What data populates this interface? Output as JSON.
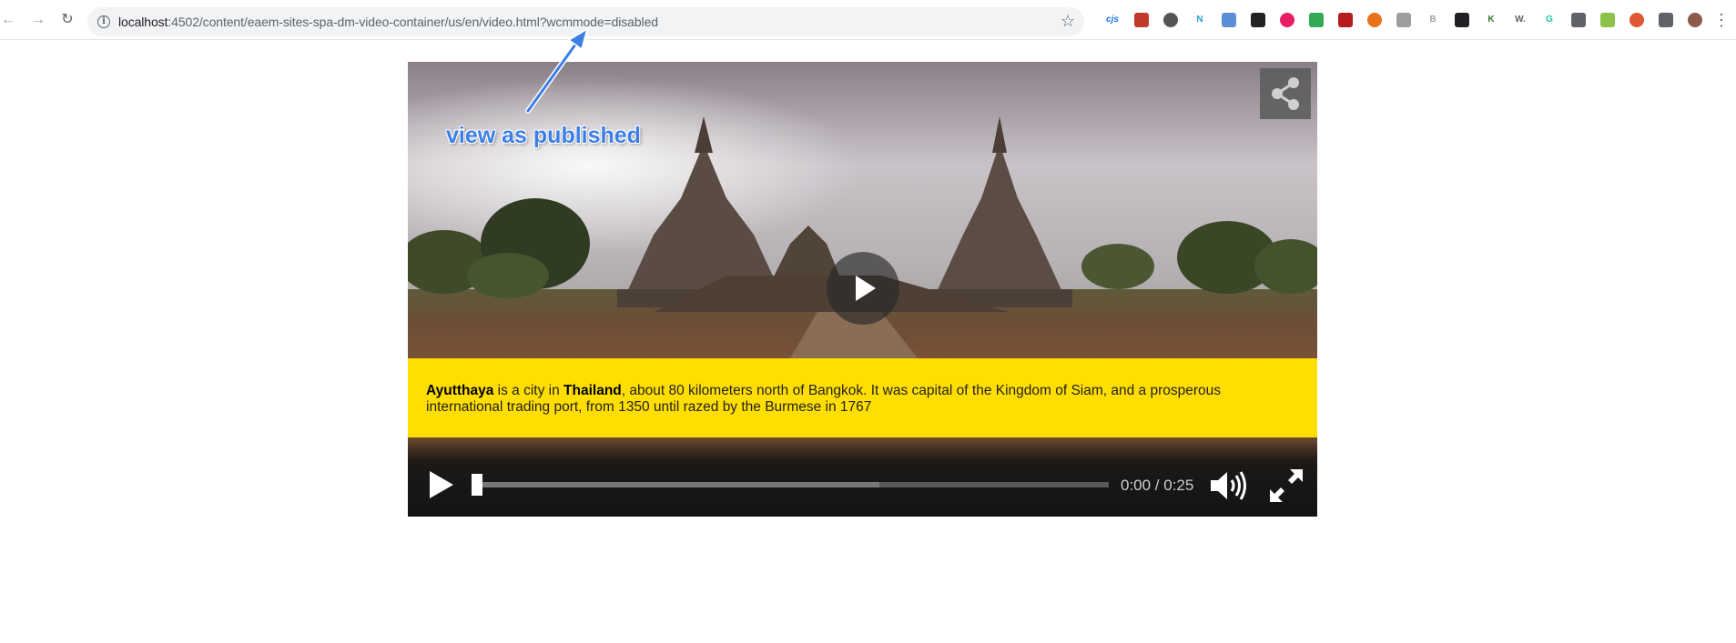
{
  "browser": {
    "url_host": "localhost",
    "url_rest": ":4502/content/eaem-sites-spa-dm-video-container/us/en/video.html?wcmmode=disabled",
    "extensions": [
      {
        "icon": "cjs-extension-icon",
        "label": "cjs",
        "color": "#1a73e8"
      },
      {
        "icon": "pen-extension-icon",
        "label": "",
        "color": "#c0392b"
      },
      {
        "icon": "circle-extension-icon",
        "label": "",
        "color": "#555555"
      },
      {
        "icon": "n-extension-icon",
        "label": "N",
        "color": "#2a9fd6"
      },
      {
        "icon": "globe-extension-icon",
        "label": "",
        "color": "#5b8dd6"
      },
      {
        "icon": "hat-extension-icon",
        "label": "",
        "color": "#222222"
      },
      {
        "icon": "target-extension-icon",
        "label": "",
        "color": "#e91e63"
      },
      {
        "icon": "drive-extension-icon",
        "label": "",
        "color": "#34a853"
      },
      {
        "icon": "square-extension-icon",
        "label": "",
        "color": "#b71c1c"
      },
      {
        "icon": "ring-extension-icon",
        "label": "",
        "color": "#e8711a"
      },
      {
        "icon": "check-extension-icon",
        "label": "",
        "color": "#9e9e9e"
      },
      {
        "icon": "b-extension-icon",
        "label": "B",
        "color": "#9e9e9e"
      },
      {
        "icon": "glasses-extension-icon",
        "label": "",
        "color": "#202124"
      },
      {
        "icon": "k-extension-icon",
        "label": "K",
        "color": "#2e7d32"
      },
      {
        "icon": "w-extension-icon",
        "label": "W.",
        "color": "#5f6368"
      },
      {
        "icon": "grammarly-extension-icon",
        "label": "G",
        "color": "#15c39a"
      },
      {
        "icon": "search-extension-icon",
        "label": "",
        "color": "#5f6368"
      },
      {
        "icon": "leaf-extension-icon",
        "label": "",
        "color": "#8bc34a"
      },
      {
        "icon": "duck-extension-icon",
        "label": "",
        "color": "#de5833"
      },
      {
        "icon": "puzzle-extension-icon",
        "label": "",
        "color": "#5f6368"
      },
      {
        "icon": "profile-avatar-icon",
        "label": "",
        "color": "#8d5a4a"
      }
    ]
  },
  "annotation": {
    "text": "view as published"
  },
  "video": {
    "caption": {
      "bold1": "Ayutthaya",
      "text1": " is a city in ",
      "bold2": "Thailand",
      "text2": ", about 80 kilometers north of Bangkok. It was capital of the Kingdom of Siam, and a prosperous international trading port, from 1350 until razed by the Burmese in 1767"
    },
    "time": "0:00 / 0:25",
    "progress": 0.0,
    "buffered": 0.64
  }
}
